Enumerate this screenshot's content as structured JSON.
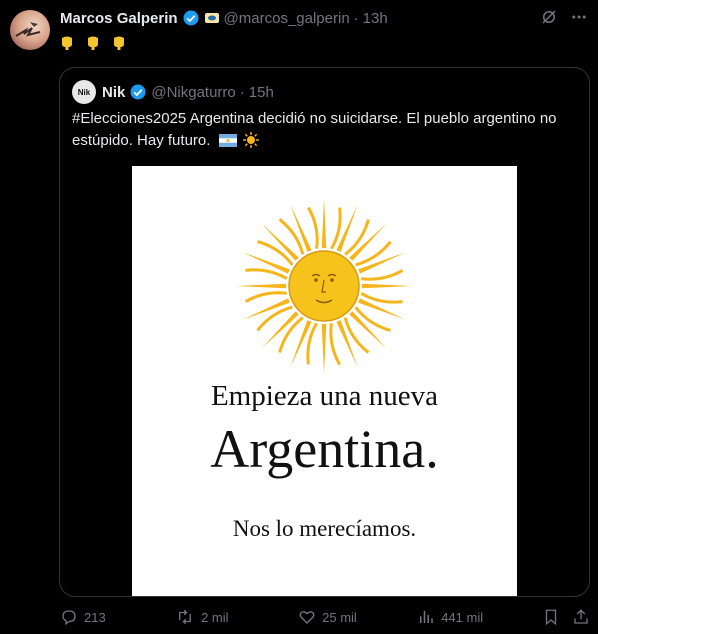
{
  "tweet": {
    "author_name": "Marcos Galperin",
    "handle": "@marcos_galperin",
    "separator": "·",
    "time": "13h",
    "emojis": "👇👇👇"
  },
  "quote": {
    "author_name": "Nik",
    "avatar_text": "Nik",
    "handle": "@Nikgaturro",
    "separator": "·",
    "time": "15h",
    "text": "#Elecciones2025 Argentina decidió no suicidarse. El pueblo argentino no estúpido. Hay futuro.",
    "image": {
      "line1": "Empieza una nueva",
      "line2": "Argentina.",
      "line3": "Nos lo merecíamos."
    }
  },
  "actions": {
    "replies": "213",
    "retweets": "2 mil",
    "likes": "25 mil",
    "views": "441 mil"
  },
  "colors": {
    "background": "#000000",
    "text": "#e7e9ea",
    "muted": "#71767b",
    "verified": "#1d9bf0",
    "sun": "#f5b51b"
  }
}
